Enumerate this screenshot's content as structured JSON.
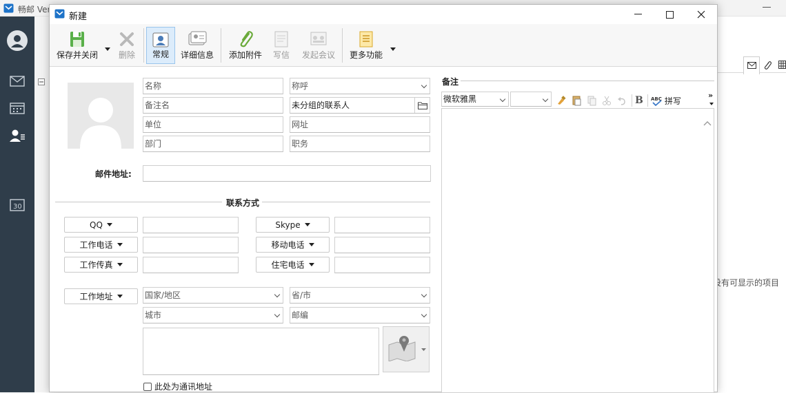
{
  "app": {
    "title": "畅邮 Ver",
    "background_text": "没有可显示的项目"
  },
  "dialog": {
    "title": "新建",
    "ribbon": {
      "save_close": "保存并关闭",
      "delete": "删除",
      "general": "常规",
      "details": "详细信息",
      "add_attachment": "添加附件",
      "write_mail": "写信",
      "meeting": "发起会议",
      "more": "更多功能"
    },
    "fields": {
      "name": "名称",
      "salutation": "称呼",
      "remark_name": "备注名",
      "group_value": "未分组的联系人",
      "company": "单位",
      "website": "网址",
      "department": "部门",
      "position": "职务"
    },
    "email_label": "邮件地址:",
    "contact_section": "联系方式",
    "contact_buttons": {
      "qq": "QQ",
      "skype": "Skype",
      "work_phone": "工作电话",
      "mobile": "移动电话",
      "work_fax": "工作传真",
      "home_phone": "住宅电话"
    },
    "address": {
      "type": "工作地址",
      "country": "国家/地区",
      "province": "省/市",
      "city": "城市",
      "zip": "邮编",
      "mailing_checkbox": "此处为通讯地址"
    },
    "notes": {
      "title": "备注",
      "font": "微软雅黑",
      "bold": "B",
      "spell": "拼写"
    }
  },
  "colors": {
    "sidebar": "#2f3d4a",
    "accent": "#1e73c8",
    "selected": "#dcecfb"
  }
}
